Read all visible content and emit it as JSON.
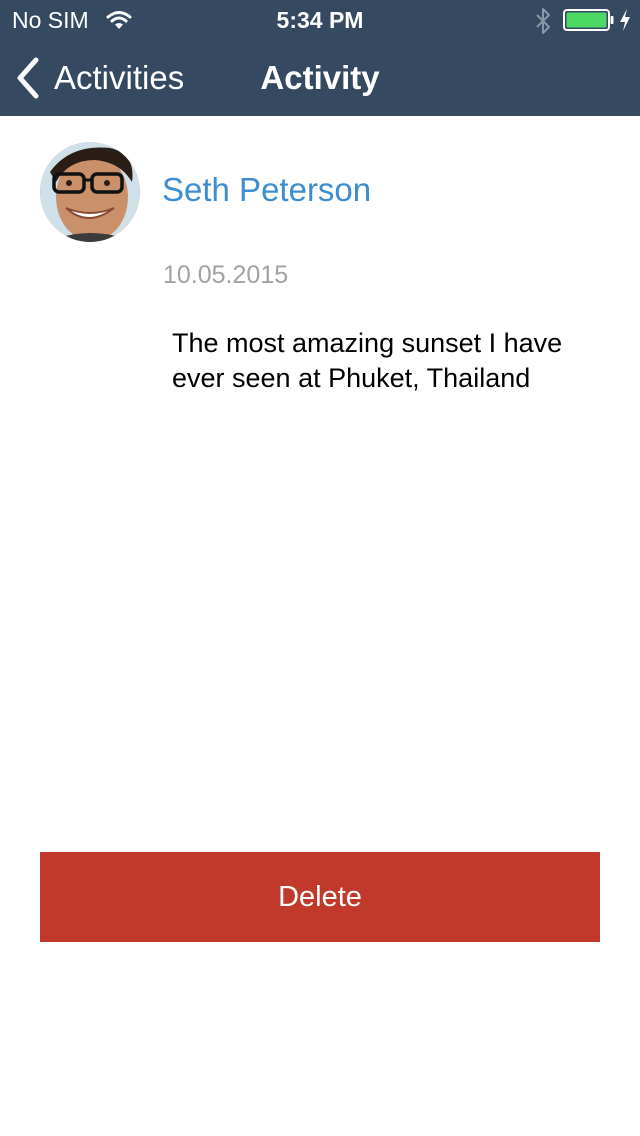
{
  "status_bar": {
    "carrier": "No SIM",
    "time": "5:34 PM",
    "icons": [
      "wifi-icon",
      "bluetooth-icon",
      "battery-icon",
      "charging-bolt-icon"
    ],
    "battery_level": 1.0
  },
  "nav_bar": {
    "back_label": "Activities",
    "title": "Activity",
    "background_color": "#354a60"
  },
  "activity": {
    "author": "Seth Peterson",
    "date": "10.05.2015",
    "text": "The most amazing sunset I have ever seen at Phuket, Thailand"
  },
  "actions": {
    "delete_label": "Delete",
    "delete_color": "#c0392b"
  },
  "colors": {
    "link": "#3c8ed0",
    "muted": "#a2a2a2"
  }
}
